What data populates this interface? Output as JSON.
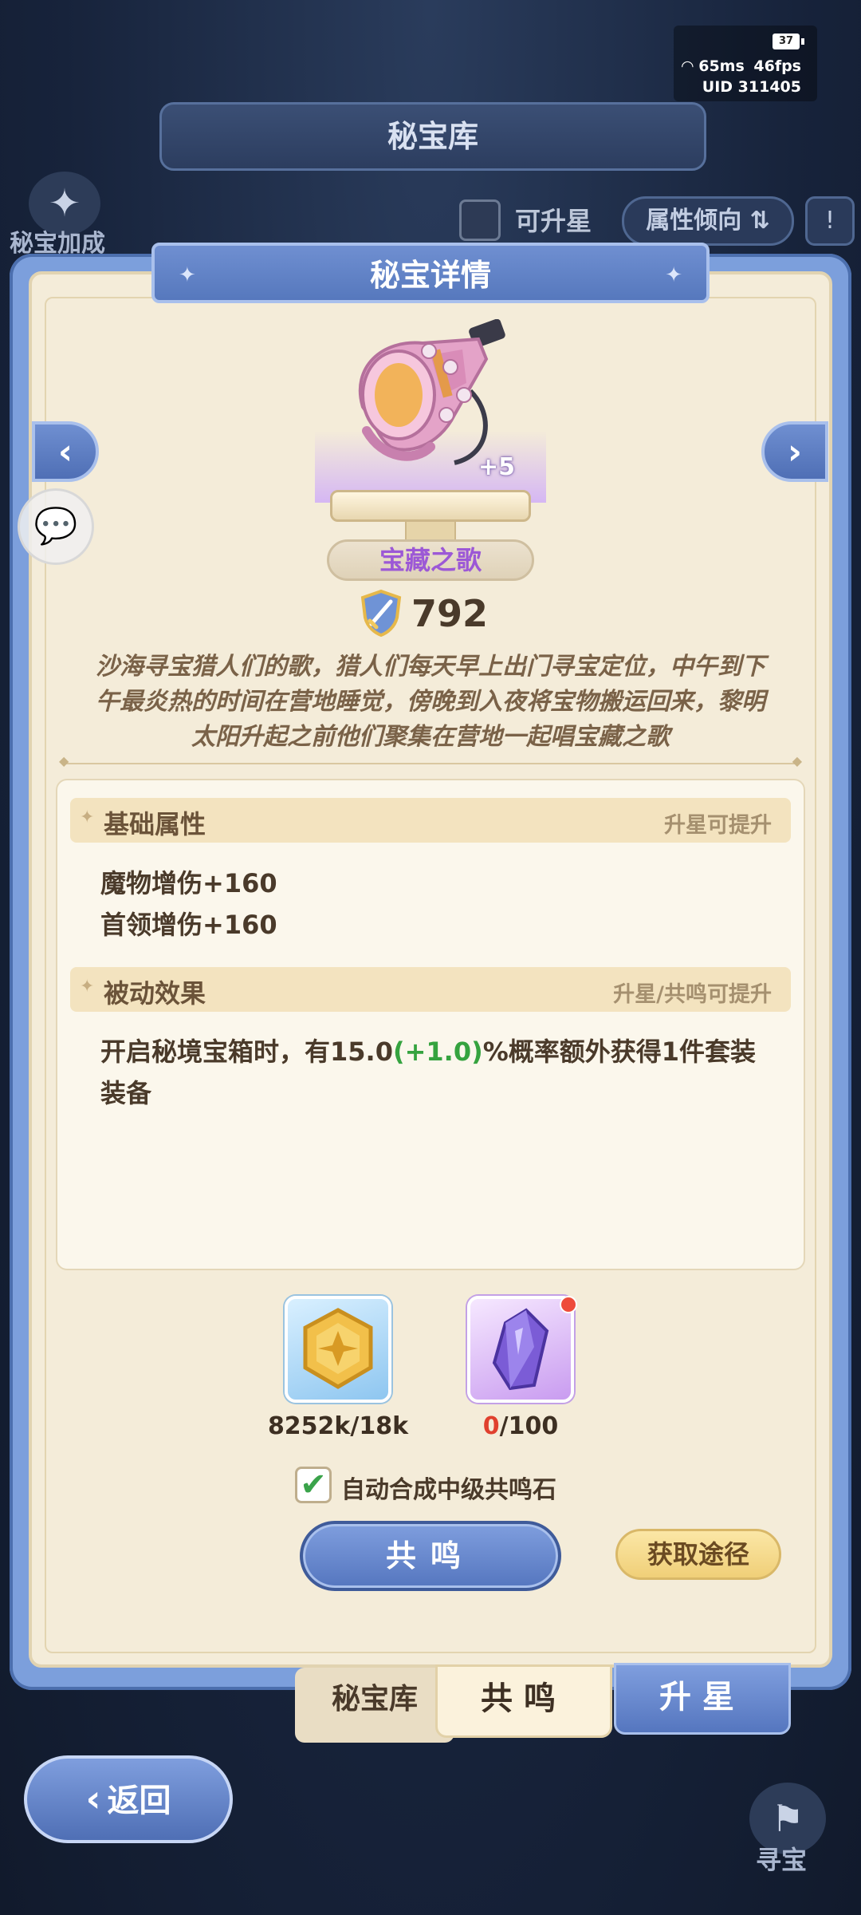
{
  "status": {
    "battery": "37",
    "ping": "65ms",
    "fps": "46fps",
    "uid": "UID 311405"
  },
  "library": {
    "title": "秘宝库",
    "bonus_label": "秘宝加成",
    "upgradable_label": "可升星",
    "attr_filter_label": "属性倾向",
    "sort_label": "!"
  },
  "dialog": {
    "title": "秘宝详情",
    "treasure_name": "宝藏之歌",
    "star_level": "+5",
    "power": "792",
    "description": "沙海寻宝猎人们的歌，猎人们每天早上出门寻宝定位，中午到下午最炎热的时间在营地睡觉，傍晚到入夜将宝物搬运回来，黎明太阳升起之前他们聚集在营地一起唱宝藏之歌",
    "basic": {
      "title": "基础属性",
      "hint": "升星可提升",
      "lines": [
        "魔物增伤+160",
        "首领增伤+160"
      ]
    },
    "passive": {
      "title": "被动效果",
      "hint": "升星/共鸣可提升",
      "text_before": "开启秘境宝箱时，有15.0",
      "text_bonus": "(+1.0)",
      "text_after": "%概率额外获得1件套装装备"
    },
    "materials": [
      {
        "icon": "gold-coin-icon",
        "count": "8252k/18k"
      },
      {
        "icon": "resonance-crystal-icon",
        "count_have": "0",
        "count_need": "/100"
      }
    ],
    "auto_label": "自动合成中级共鸣石",
    "auto_checked": true,
    "resonate_button": "共鸣",
    "obtain_button": "获取途径"
  },
  "tabs": {
    "library": "秘宝库",
    "resonate": "共鸣",
    "upgrade": "升星"
  },
  "back_label": "返回",
  "hunt_label": "寻宝",
  "colors": {
    "accent_blue": "#5576bf",
    "panel": "#f4ecd9",
    "green": "#35a33f",
    "purple_name": "#9c58d6"
  }
}
